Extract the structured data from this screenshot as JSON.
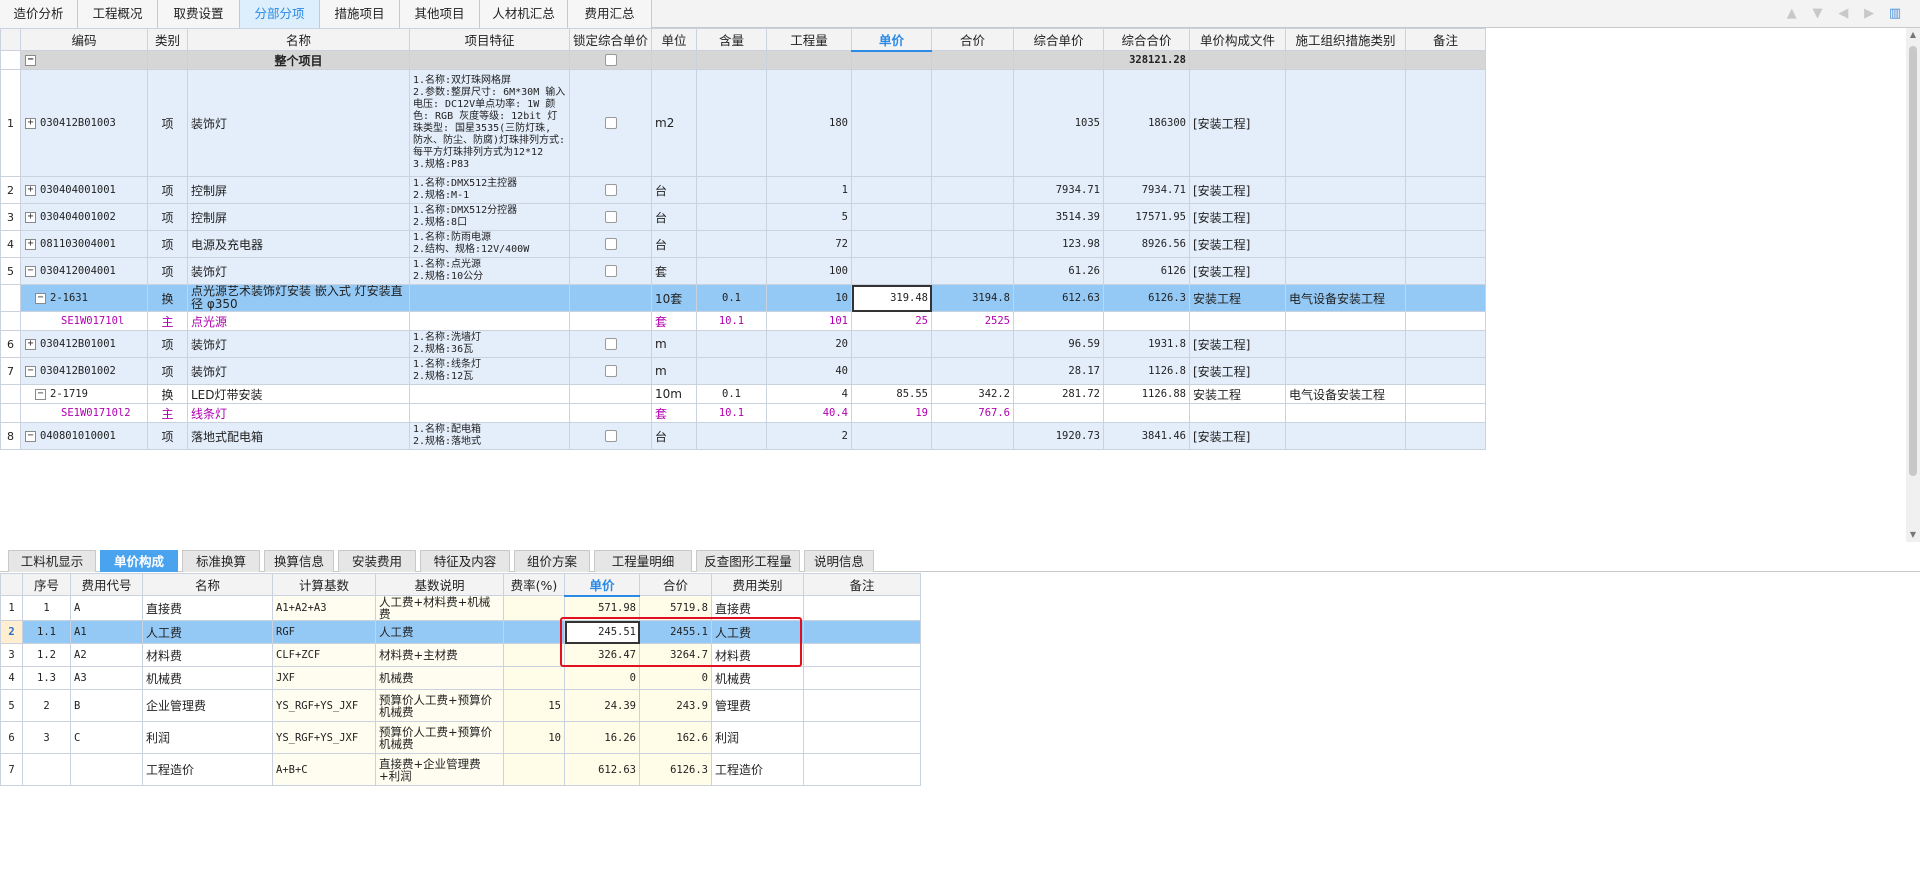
{
  "top_tabs": [
    {
      "label": "造价分析",
      "active": false
    },
    {
      "label": "工程概况",
      "active": false
    },
    {
      "label": "取费设置",
      "active": false
    },
    {
      "label": "分部分项",
      "active": true
    },
    {
      "label": "措施项目",
      "active": false
    },
    {
      "label": "其他项目",
      "active": false
    },
    {
      "label": "人材机汇总",
      "active": false
    },
    {
      "label": "费用汇总",
      "active": false
    }
  ],
  "top_icons": [
    "move-top-icon",
    "move-down-icon",
    "move-left-icon",
    "move-right-icon",
    "chart-settings-icon"
  ],
  "main_table": {
    "headers": [
      "",
      "编码",
      "类别",
      "名称",
      "项目特征",
      "锁定综合单价",
      "单位",
      "含量",
      "工程量",
      "单价",
      "合价",
      "综合单价",
      "综合合价",
      "单价构成文件",
      "施工组织措施类别",
      "备注"
    ],
    "rows": [
      {
        "type": "total",
        "no": "",
        "expand": "−",
        "code": "",
        "kind": "",
        "name": "整个项目",
        "feature": "",
        "lock": true,
        "unit": "",
        "content": "",
        "qty": "",
        "price": "",
        "amount": "",
        "comp_price": "",
        "comp_amount": "328121.28",
        "file": "",
        "measure": "",
        "note": ""
      },
      {
        "type": "qd",
        "no": "1",
        "expand": "+",
        "code": "030412B01003",
        "kind": "项",
        "name": "装饰灯",
        "feature": "1.名称:双灯珠网格屏\n2.参数:整屏尺寸: 6M*30M 输入电压: DC12V单点功率: 1W 颜色: RGB 灰度等级: 12bit 灯珠类型: 国星3535(三防灯珠, 防水、防尘、防腐)灯珠排列方式: 每平方灯珠排列方式为12*12\n3.规格:P83",
        "lock": true,
        "unit": "m2",
        "content": "",
        "qty": "180",
        "price": "",
        "amount": "",
        "comp_price": "1035",
        "comp_amount": "186300",
        "file": "[安装工程]",
        "measure": "",
        "note": ""
      },
      {
        "type": "qd",
        "no": "2",
        "expand": "+",
        "code": "030404001001",
        "kind": "项",
        "name": "控制屏",
        "feature": "1.名称:DMX512主控器\n2.规格:M-1",
        "lock": true,
        "unit": "台",
        "content": "",
        "qty": "1",
        "price": "",
        "amount": "",
        "comp_price": "7934.71",
        "comp_amount": "7934.71",
        "file": "[安装工程]",
        "measure": "",
        "note": ""
      },
      {
        "type": "qd",
        "no": "3",
        "expand": "+",
        "code": "030404001002",
        "kind": "项",
        "name": "控制屏",
        "feature": "1.名称:DMX512分控器\n2.规格:8口",
        "lock": true,
        "unit": "台",
        "content": "",
        "qty": "5",
        "price": "",
        "amount": "",
        "comp_price": "3514.39",
        "comp_amount": "17571.95",
        "file": "[安装工程]",
        "measure": "",
        "note": ""
      },
      {
        "type": "qd",
        "no": "4",
        "expand": "+",
        "code": "081103004001",
        "kind": "项",
        "name": "电源及充电器",
        "feature": "1.名称:防雨电源\n2.结构、规格:12V/400W",
        "lock": true,
        "unit": "台",
        "content": "",
        "qty": "72",
        "price": "",
        "amount": "",
        "comp_price": "123.98",
        "comp_amount": "8926.56",
        "file": "[安装工程]",
        "measure": "",
        "note": ""
      },
      {
        "type": "qd",
        "no": "5",
        "expand": "−",
        "code": "030412004001",
        "kind": "项",
        "name": "装饰灯",
        "feature": "1.名称:点光源\n2.规格:10公分",
        "lock": true,
        "unit": "套",
        "content": "",
        "qty": "100",
        "price": "",
        "amount": "",
        "comp_price": "61.26",
        "comp_amount": "6126",
        "file": "[安装工程]",
        "measure": "",
        "note": ""
      },
      {
        "type": "sel",
        "no": "",
        "expand": "−",
        "code": "2-1631",
        "kind": "换",
        "name": "点光源艺术装饰灯安装 嵌入式 灯安装直径 φ350",
        "feature": "",
        "lock": null,
        "unit": "10套",
        "content": "0.1",
        "qty": "10",
        "price": "319.48",
        "amount": "3194.8",
        "comp_price": "612.63",
        "comp_amount": "6126.3",
        "file": "安装工程",
        "measure": "电气设备安装工程",
        "note": ""
      },
      {
        "type": "main",
        "no": "",
        "expand": "",
        "code": "SE1W01710l",
        "kind": "主",
        "name": "点光源",
        "feature": "",
        "lock": null,
        "unit": "套",
        "content": "10.1",
        "qty": "101",
        "price": "25",
        "amount": "2525",
        "comp_price": "",
        "comp_amount": "",
        "file": "",
        "measure": "",
        "note": ""
      },
      {
        "type": "qd",
        "no": "6",
        "expand": "+",
        "code": "030412B01001",
        "kind": "项",
        "name": "装饰灯",
        "feature": "1.名称:洗墙灯\n2.规格:36瓦",
        "lock": true,
        "unit": "m",
        "content": "",
        "qty": "20",
        "price": "",
        "amount": "",
        "comp_price": "96.59",
        "comp_amount": "1931.8",
        "file": "[安装工程]",
        "measure": "",
        "note": ""
      },
      {
        "type": "qd",
        "no": "7",
        "expand": "−",
        "code": "030412B01002",
        "kind": "项",
        "name": "装饰灯",
        "feature": "1.名称:线条灯\n2.规格:12瓦",
        "lock": true,
        "unit": "m",
        "content": "",
        "qty": "40",
        "price": "",
        "amount": "",
        "comp_price": "28.17",
        "comp_amount": "1126.8",
        "file": "[安装工程]",
        "measure": "",
        "note": ""
      },
      {
        "type": "sub",
        "no": "",
        "expand": "−",
        "code": "2-1719",
        "kind": "换",
        "name": "LED灯带安装",
        "feature": "",
        "lock": null,
        "unit": "10m",
        "content": "0.1",
        "qty": "4",
        "price": "85.55",
        "amount": "342.2",
        "comp_price": "281.72",
        "comp_amount": "1126.88",
        "file": "安装工程",
        "measure": "电气设备安装工程",
        "note": ""
      },
      {
        "type": "main",
        "no": "",
        "expand": "",
        "code": "SE1W01710l2",
        "kind": "主",
        "name": "线条灯",
        "feature": "",
        "lock": null,
        "unit": "套",
        "content": "10.1",
        "qty": "40.4",
        "price": "19",
        "amount": "767.6",
        "comp_price": "",
        "comp_amount": "",
        "file": "",
        "measure": "",
        "note": ""
      },
      {
        "type": "qd",
        "no": "8",
        "expand": "−",
        "code": "040801010001",
        "kind": "项",
        "name": "落地式配电箱",
        "feature": "1.名称:配电箱\n2.规格:落地式",
        "lock": true,
        "unit": "台",
        "content": "",
        "qty": "2",
        "price": "",
        "amount": "",
        "comp_price": "1920.73",
        "comp_amount": "3841.46",
        "file": "[安装工程]",
        "measure": "",
        "note": ""
      }
    ]
  },
  "bottom_tabs": [
    {
      "label": "工料机显示",
      "active": false
    },
    {
      "label": "单价构成",
      "active": true
    },
    {
      "label": "标准换算",
      "active": false
    },
    {
      "label": "换算信息",
      "active": false
    },
    {
      "label": "安装费用",
      "active": false
    },
    {
      "label": "特征及内容",
      "active": false
    },
    {
      "label": "组价方案",
      "active": false
    },
    {
      "label": "工程量明细",
      "active": false
    },
    {
      "label": "反查图形工程量",
      "active": false
    },
    {
      "label": "说明信息",
      "active": false
    }
  ],
  "cost_table": {
    "headers": [
      "",
      "序号",
      "费用代号",
      "名称",
      "计算基数",
      "基数说明",
      "费率(%)",
      "单价",
      "合价",
      "费用类别",
      "备注"
    ],
    "rows": [
      {
        "no": "1",
        "seq": "1",
        "code": "A",
        "name": "直接费",
        "base": "A1+A2+A3",
        "desc": "人工费+材料费+机械费",
        "rate": "",
        "price": "571.98",
        "amount": "5719.8",
        "category": "直接费",
        "note": "",
        "selected": false
      },
      {
        "no": "2",
        "seq": "1.1",
        "code": "A1",
        "name": "人工费",
        "base": "RGF",
        "desc": "人工费",
        "rate": "",
        "price": "245.51",
        "amount": "2455.1",
        "category": "人工费",
        "note": "",
        "selected": true
      },
      {
        "no": "3",
        "seq": "1.2",
        "code": "A2",
        "name": "材料费",
        "base": "CLF+ZCF",
        "desc": "材料费+主材费",
        "rate": "",
        "price": "326.47",
        "amount": "3264.7",
        "category": "材料费",
        "note": "",
        "selected": false
      },
      {
        "no": "4",
        "seq": "1.3",
        "code": "A3",
        "name": "机械费",
        "base": "JXF",
        "desc": "机械费",
        "rate": "",
        "price": "0",
        "amount": "0",
        "category": "机械费",
        "note": "",
        "selected": false
      },
      {
        "no": "5",
        "seq": "2",
        "code": "B",
        "name": "企业管理费",
        "base": "YS_RGF+YS_JXF",
        "desc": "预算价人工费+预算价机械费",
        "rate": "15",
        "price": "24.39",
        "amount": "243.9",
        "category": "管理费",
        "note": "",
        "selected": false
      },
      {
        "no": "6",
        "seq": "3",
        "code": "C",
        "name": "利润",
        "base": "YS_RGF+YS_JXF",
        "desc": "预算价人工费+预算价机械费",
        "rate": "10",
        "price": "16.26",
        "amount": "162.6",
        "category": "利润",
        "note": "",
        "selected": false
      },
      {
        "no": "7",
        "seq": "",
        "code": "",
        "name": "工程造价",
        "base": "A+B+C",
        "desc": "直接费+企业管理费+利润",
        "rate": "",
        "price": "612.63",
        "amount": "6126.3",
        "category": "工程造价",
        "note": "",
        "selected": false
      }
    ]
  }
}
